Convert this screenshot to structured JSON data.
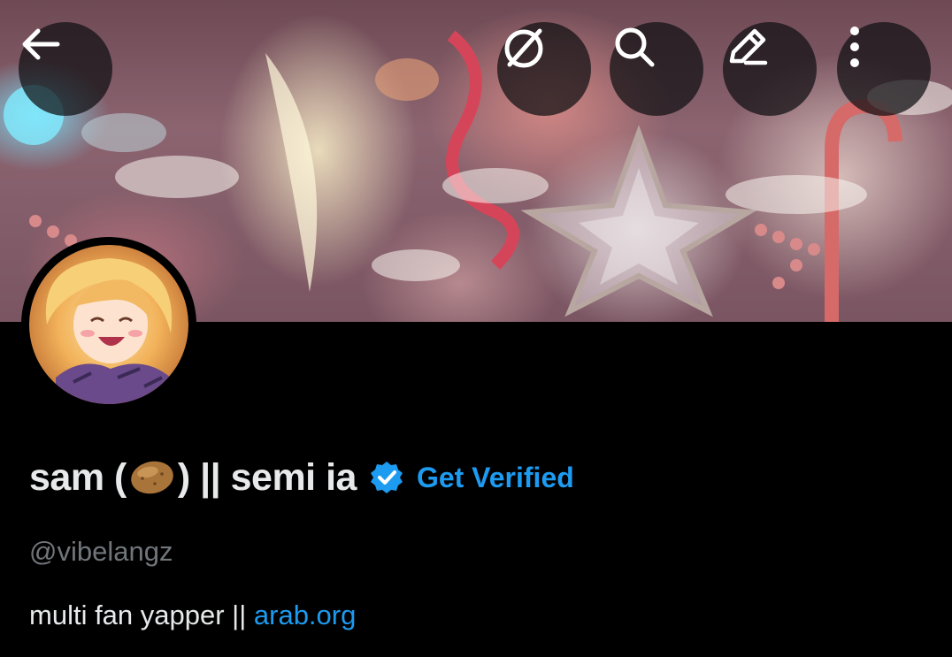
{
  "header": {
    "back_icon": "arrow-left-icon",
    "actions": [
      {
        "name": "grok-icon"
      },
      {
        "name": "search-icon"
      },
      {
        "name": "edit-icon"
      },
      {
        "name": "more-vertical-icon"
      }
    ]
  },
  "profile": {
    "display_name_prefix": "sam (",
    "display_name_emoji": "potato-emoji",
    "display_name_suffix": ") || semi ia",
    "verified_badge": "verified-badge-icon",
    "get_verified_label": "Get Verified",
    "handle": "@vibelangz",
    "bio_text": "multi fan yapper || ",
    "bio_link": "arab.org"
  },
  "colors": {
    "background": "#000000",
    "accent": "#1d9bf0",
    "text_primary": "#e7e9ea",
    "text_secondary": "#71767b"
  }
}
